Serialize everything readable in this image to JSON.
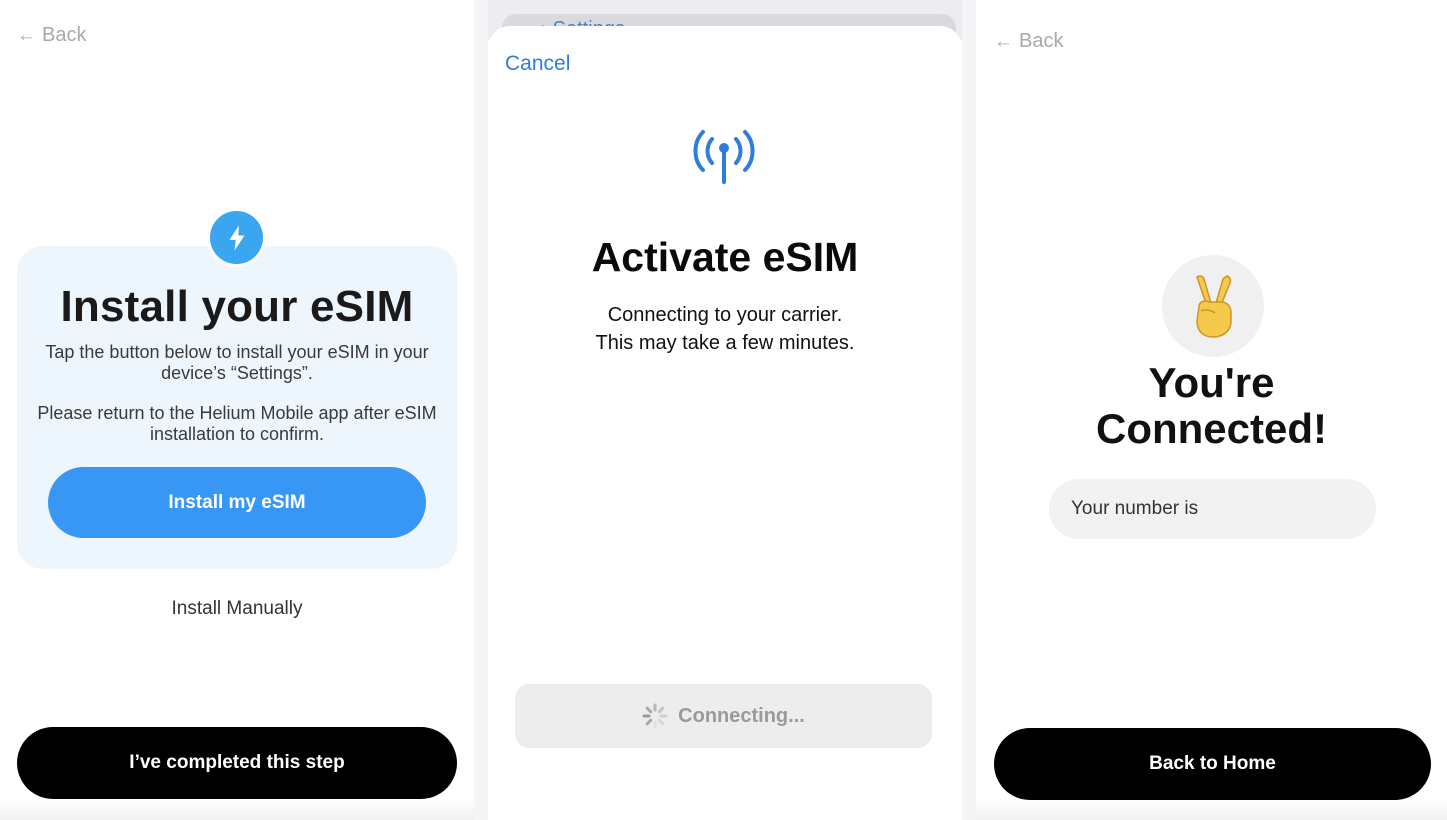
{
  "panel1": {
    "back_label": "Back",
    "title": "Install your eSIM",
    "text1": "Tap the button below to install your eSIM in your device’s “Settings”.",
    "text2": "Please return to the Helium Mobile app after eSIM installation to confirm.",
    "install_button": "Install my eSIM",
    "install_manually": "Install Manually",
    "completed_button": "I’ve completed this step",
    "badge_icon": "lightning-bolt-icon",
    "accent_color": "#3897f5"
  },
  "panel2": {
    "settings_label": "Settings",
    "cancel_label": "Cancel",
    "antenna_icon": "antenna-signal-icon",
    "title": "Activate eSIM",
    "line1": "Connecting to your carrier.",
    "line2": "This may take a few minutes.",
    "connecting_label": "Connecting...",
    "link_color": "#2e7ddc"
  },
  "panel3": {
    "back_label": "Back",
    "emoji": "✌️",
    "title_line1": "You're",
    "title_line2": "Connected!",
    "number_label": "Your number is",
    "home_button": "Back to Home"
  }
}
